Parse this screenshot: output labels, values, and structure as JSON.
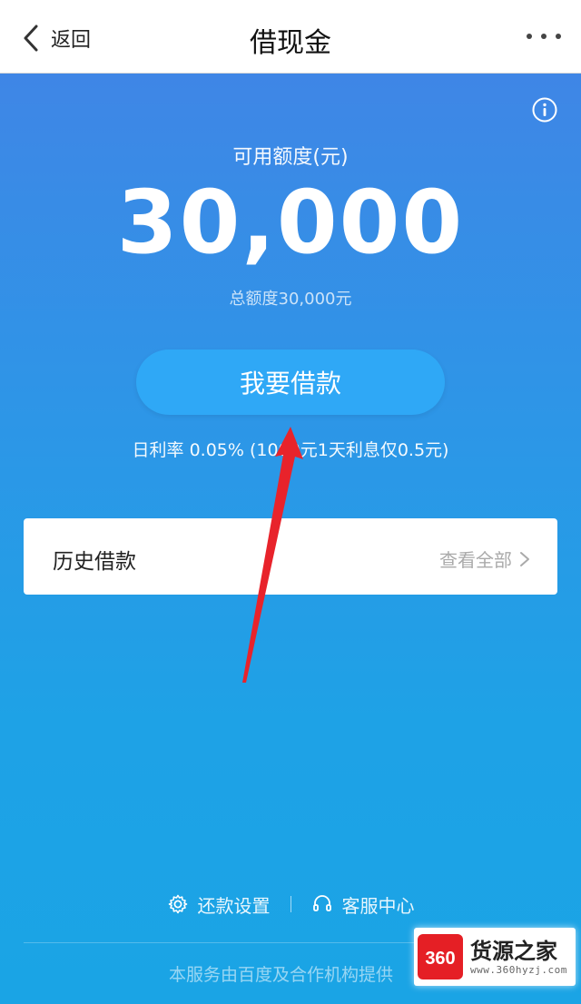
{
  "header": {
    "back_label": "返回",
    "title": "借现金",
    "icons": {
      "back": "chevron-left-icon",
      "more": "more-dots-icon"
    }
  },
  "credit": {
    "available_label": "可用额度(元)",
    "available_amount": "30,000",
    "total_label": "总额度30,000元",
    "info_icon": "info-icon"
  },
  "actions": {
    "borrow_button": "我要借款"
  },
  "rate": {
    "text": "日利率 0.05% (1000元1天利息仅0.5元)"
  },
  "history": {
    "title": "历史借款",
    "view_all": "查看全部"
  },
  "footer": {
    "repayment_settings": "还款设置",
    "customer_service": "客服中心",
    "note": "本服务由百度及合作机构提供"
  },
  "watermark": {
    "logo_text": "360",
    "name": "货源之家",
    "url": "www.360hyzj.com"
  },
  "colors": {
    "accent_blue": "#2fa8f6",
    "background_top": "#3f86e6",
    "background_bottom": "#1aa4e5",
    "annotation_arrow": "#e8232b"
  }
}
